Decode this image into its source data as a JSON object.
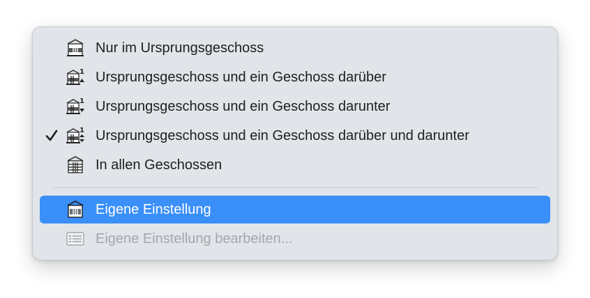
{
  "menu": {
    "items": [
      {
        "label": "Nur im Ursprungsgeschoss",
        "icon": "floor-origin-only-icon",
        "checked": false
      },
      {
        "label": "Ursprungsgeschoss und ein Geschoss darüber",
        "icon": "floor-origin-above-icon",
        "checked": false
      },
      {
        "label": "Ursprungsgeschoss und ein Geschoss darunter",
        "icon": "floor-origin-below-icon",
        "checked": false
      },
      {
        "label": "Ursprungsgeschoss und ein Geschoss darüber und darunter",
        "icon": "floor-origin-above-below-icon",
        "checked": true
      },
      {
        "label": "In allen Geschossen",
        "icon": "floor-all-icon",
        "checked": false
      }
    ],
    "custom_items": [
      {
        "label": "Eigene Einstellung",
        "icon": "floor-custom-icon",
        "state": "highlighted"
      },
      {
        "label": "Eigene Einstellung bearbeiten...",
        "icon": "list-edit-icon",
        "state": "disabled"
      }
    ],
    "checkmark": "✓"
  },
  "colors": {
    "menu_background": "#e1e4e9",
    "highlight": "#3a8ff9",
    "text": "#1e1e1e",
    "disabled_text": "#a4a7ac"
  }
}
